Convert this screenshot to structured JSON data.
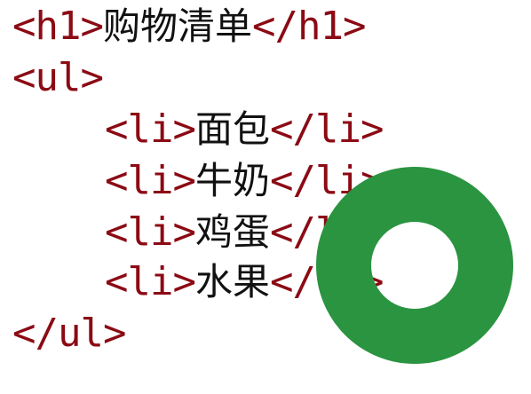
{
  "code": {
    "h1": {
      "open": "<h1>",
      "text": "购物清单",
      "close": "</h1>"
    },
    "ul_open": "<ul>",
    "items": [
      {
        "open": "<li>",
        "text": "面包",
        "close": "</li>"
      },
      {
        "open": "<li>",
        "text": "牛奶",
        "close": "</li>"
      },
      {
        "open": "<li>",
        "text": "鸡蛋",
        "close": "</li>"
      },
      {
        "open": "<li>",
        "text": "水果",
        "close": "</li>"
      }
    ],
    "ul_close": "</ul>"
  },
  "overlay": {
    "icon": "loading-ring-icon",
    "color": "#2a9440"
  },
  "colors": {
    "tag": "#8b0a14",
    "text": "#111111",
    "background": "#ffffff"
  }
}
